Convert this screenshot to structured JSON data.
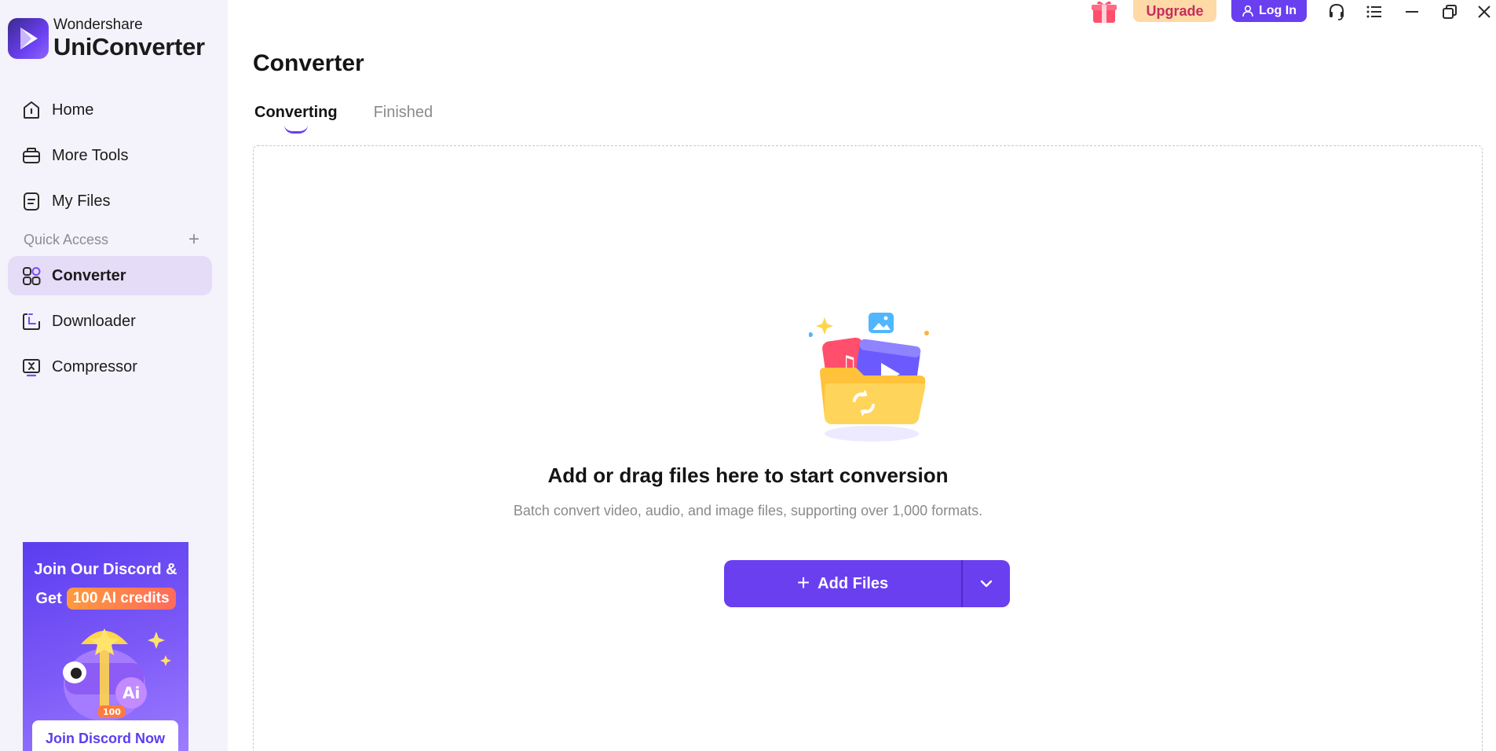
{
  "brand": {
    "sub": "Wondershare",
    "main": "UniConverter"
  },
  "sidebar": {
    "items": [
      {
        "label": "Home",
        "icon": "home-icon"
      },
      {
        "label": "More Tools",
        "icon": "toolbox-icon"
      },
      {
        "label": "My Files",
        "icon": "file-icon"
      }
    ],
    "quick_access_label": "Quick Access",
    "quick_items": [
      {
        "label": "Converter",
        "icon": "converter-icon",
        "active": true
      },
      {
        "label": "Downloader",
        "icon": "download-icon"
      },
      {
        "label": "Compressor",
        "icon": "compress-icon"
      }
    ]
  },
  "promo": {
    "line1": "Join Our Discord &",
    "line2_prefix": "Get",
    "line2_highlight": "100 AI credits",
    "badge": "100",
    "button": "Join Discord Now"
  },
  "topbar": {
    "upgrade": "Upgrade",
    "login": "Log In",
    "icons": [
      "gift-icon",
      "headset-icon",
      "menu-icon",
      "minimize-icon",
      "restore-icon",
      "close-icon"
    ]
  },
  "main": {
    "title": "Converter",
    "tabs": [
      {
        "label": "Converting",
        "active": true
      },
      {
        "label": "Finished",
        "active": false
      }
    ],
    "dropzone": {
      "title": "Add or drag files here to start conversion",
      "subtitle": "Batch convert video, audio, and image files, supporting over 1,000 formats.",
      "add_button": "Add Files"
    }
  },
  "colors": {
    "accent": "#6a3ff0",
    "sidebar_bg": "#f4f3fb",
    "active_item_bg": "#e5dcf8",
    "upgrade_bg": "#ffd9a6",
    "upgrade_text": "#c42d5e"
  }
}
